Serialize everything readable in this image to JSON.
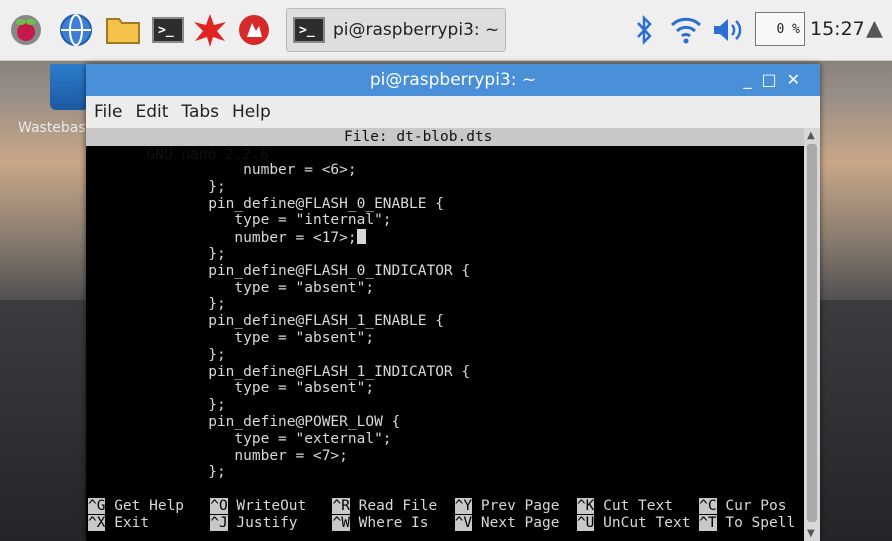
{
  "taskbar": {
    "task_label": "pi@raspberrypi3: ~",
    "cpu_usage": "0 %",
    "clock": "15:27"
  },
  "desktop": {
    "trash_label": "Wastebasket"
  },
  "window": {
    "title": "pi@raspberrypi3: ~",
    "menu": [
      "File",
      "Edit",
      "Tabs",
      "Help"
    ]
  },
  "nano": {
    "version": "GNU nano 2.2.6",
    "file": "File: dt-blob.dts",
    "lines": [
      "                  number = <6>;",
      "              };",
      "              pin_define@FLASH_0_ENABLE {",
      "                 type = \"internal\";",
      "                 number = <17>;",
      "              };",
      "              pin_define@FLASH_0_INDICATOR {",
      "                 type = \"absent\";",
      "              };",
      "              pin_define@FLASH_1_ENABLE {",
      "                 type = \"absent\";",
      "              };",
      "              pin_define@FLASH_1_INDICATOR {",
      "                 type = \"absent\";",
      "              };",
      "              pin_define@POWER_LOW {",
      "                 type = \"external\";",
      "                 number = <7>;",
      "              };"
    ],
    "shortcuts_row1": [
      {
        "key": "^G",
        "label": " Get Help  "
      },
      {
        "key": "^O",
        "label": " WriteOut  "
      },
      {
        "key": "^R",
        "label": " Read File "
      },
      {
        "key": "^Y",
        "label": " Prev Page "
      },
      {
        "key": "^K",
        "label": " Cut Text  "
      },
      {
        "key": "^C",
        "label": " Cur Pos"
      }
    ],
    "shortcuts_row2": [
      {
        "key": "^X",
        "label": " Exit      "
      },
      {
        "key": "^J",
        "label": " Justify   "
      },
      {
        "key": "^W",
        "label": " Where Is  "
      },
      {
        "key": "^V",
        "label": " Next Page "
      },
      {
        "key": "^U",
        "label": " UnCut Text"
      },
      {
        "key": "^T",
        "label": " To Spell"
      }
    ]
  }
}
